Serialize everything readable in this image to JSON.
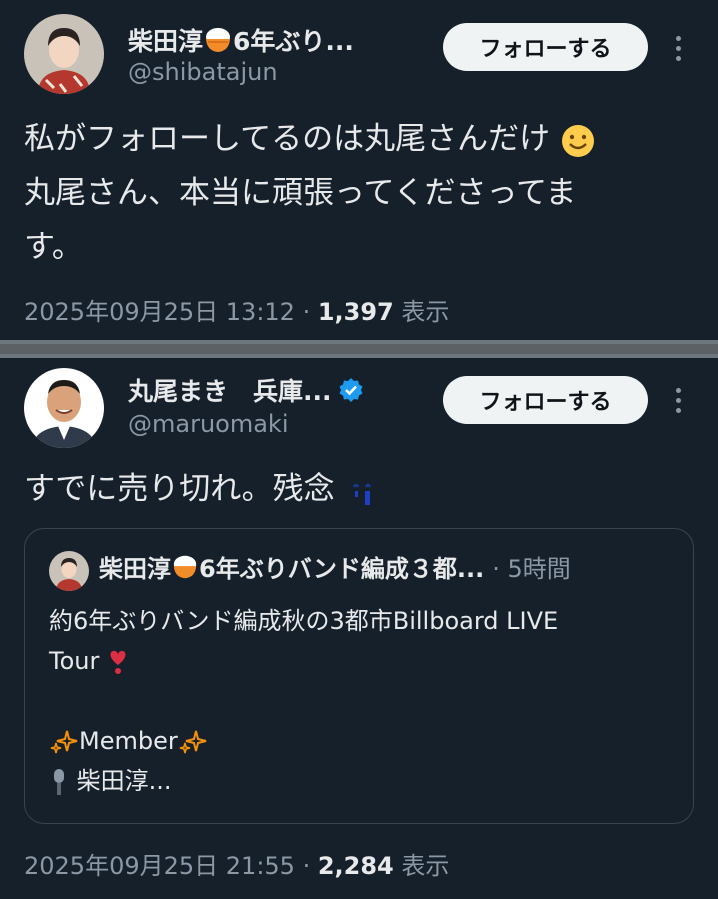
{
  "colors": {
    "background": "#15202b",
    "text": "#e7e9ea",
    "muted": "#8b98a5",
    "verified": "#1d9bf0",
    "follow_bg": "#eff3f4"
  },
  "post1": {
    "display_name": "柴田淳",
    "name_suffix": "6年ぶり...",
    "handle": "@shibatajun",
    "follow_label": "フォローする",
    "text_line1": "私がフォローしてるのは丸尾さんだけ",
    "text_line2": "丸尾さん、本当に頑張ってくださってま",
    "text_line3": "す。",
    "time": "2025年09月25日 13:12 · ",
    "views_count": "1,397",
    "views_label": " 表示",
    "icons": [
      "rice-bowl-emoji",
      "smiley-emoji",
      "more-icon"
    ]
  },
  "post2": {
    "display_name": "丸尾まき　兵庫...",
    "handle": "@maruomaki",
    "follow_label": "フォローする",
    "text": "すでに売り切れ。残念",
    "time": "2025年09月25日 21:55 · ",
    "views_count": "2,284",
    "views_label": " 表示",
    "icons": [
      "verified-badge-icon",
      "tears-emoji",
      "more-icon"
    ]
  },
  "quote": {
    "display_name": "柴田淳",
    "name_suffix": "6年ぶりバンド編成３都...",
    "time": "· 5時間",
    "line1": "約6年ぶりバンド編成秋の3都市Billboard LIVE",
    "line2": "Tour",
    "line3": "Member",
    "line4": "柴田淳...",
    "icons": [
      "heart-exclamation-emoji",
      "sparkles-emoji",
      "microphone-emoji"
    ]
  }
}
